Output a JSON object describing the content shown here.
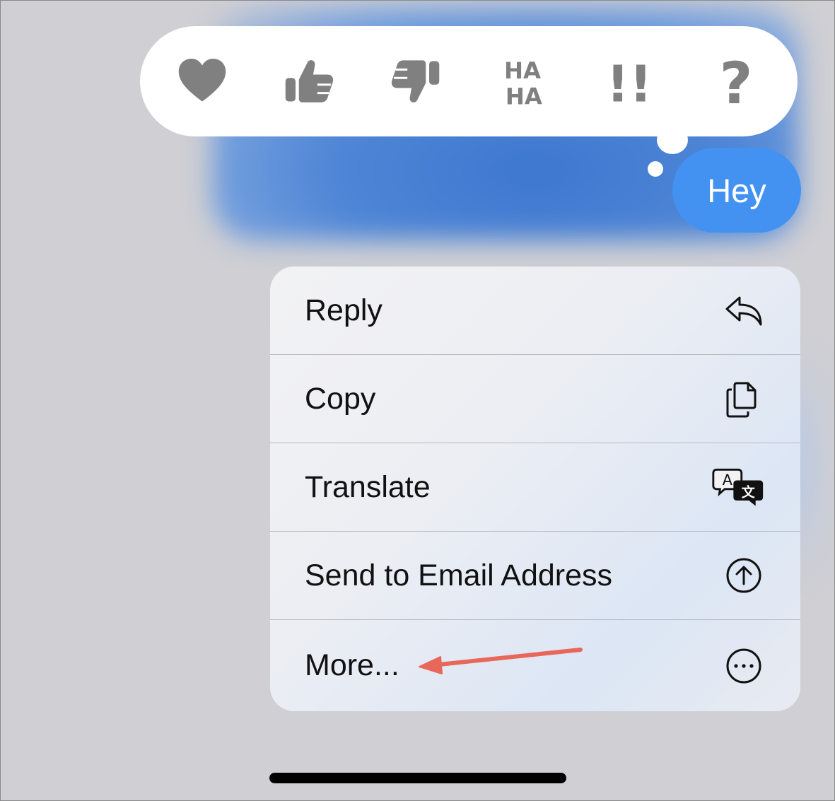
{
  "tapbacks": [
    {
      "name": "heart",
      "icon": "heart-icon"
    },
    {
      "name": "thumbs-up",
      "icon": "thumbs-up-icon"
    },
    {
      "name": "thumbs-down",
      "icon": "thumbs-down-icon"
    },
    {
      "name": "haha",
      "icon": "haha-icon",
      "text_top": "HA",
      "text_bottom": "HA"
    },
    {
      "name": "emphasize",
      "icon": "double-exclamation-icon",
      "text": "!!"
    },
    {
      "name": "question",
      "icon": "question-mark-icon",
      "text": "?"
    }
  ],
  "message": {
    "text": "Hey"
  },
  "menu": {
    "items": [
      {
        "label": "Reply",
        "icon": "reply-arrow-icon"
      },
      {
        "label": "Copy",
        "icon": "copy-documents-icon"
      },
      {
        "label": "Translate",
        "icon": "translate-icon",
        "glyph_a": "A",
        "glyph_b": "文"
      },
      {
        "label": "Send to Email Address",
        "icon": "share-up-arrow-circle-icon"
      },
      {
        "label": "More...",
        "icon": "ellipsis-circle-icon"
      }
    ]
  },
  "colors": {
    "bubble": "#4392f1",
    "tapback_icon": "#808080",
    "annotation_arrow": "#e8675a"
  }
}
